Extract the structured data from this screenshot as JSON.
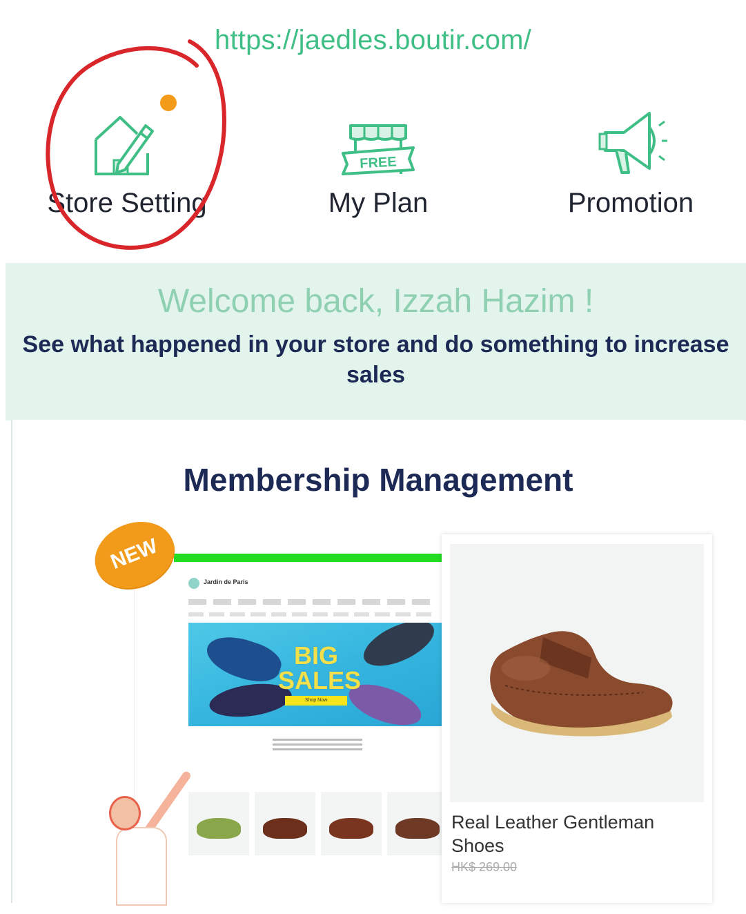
{
  "store": {
    "url": "https://jaedles.boutir.com/"
  },
  "shortcuts": [
    {
      "label": "Store Setting",
      "icon": "store-edit-icon",
      "has_notification_dot": true
    },
    {
      "label": "My Plan",
      "icon": "free-plan-icon",
      "badge_text": "FREE"
    },
    {
      "label": "Promotion",
      "icon": "megaphone-icon"
    }
  ],
  "welcome": {
    "title": "Welcome back, Izzah Hazim !",
    "subtitle": "See what happened in your store and do something to increase sales"
  },
  "membership_card": {
    "title": "Membership Management",
    "new_badge": "NEW",
    "mock_site": {
      "store_name": "Jardin de Paris",
      "banner_text": "BIG SALES",
      "banner_button": "Shop Now"
    },
    "product": {
      "name": "Real Leather Gentleman Shoes",
      "price": "HK$ 269.00"
    }
  },
  "colors": {
    "accent_green": "#3fbf86",
    "welcome_bg": "#e3f4ec",
    "navy_text": "#1d2a55",
    "annotation_red": "#d8262b",
    "badge_orange": "#f29a1a"
  }
}
